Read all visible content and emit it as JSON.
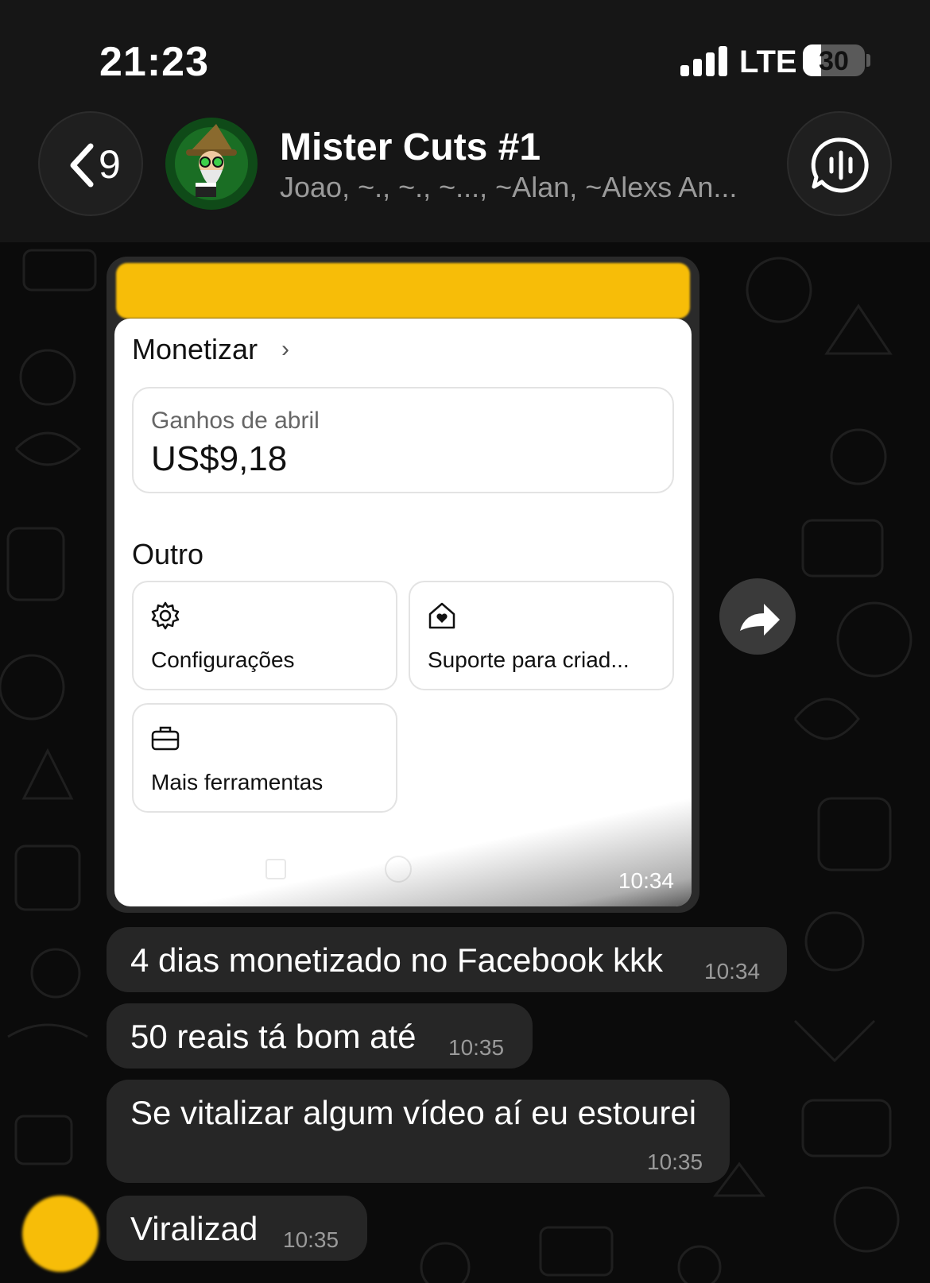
{
  "status_bar": {
    "time": "21:23",
    "network": "LTE",
    "battery": "30",
    "battery_level": 0.3
  },
  "header": {
    "back_count": "9",
    "group_name": "Mister Cuts #1",
    "members": "Joao, ~., ~., ~..., ~Alan, ~Alexs An..."
  },
  "image_message": {
    "time": "10:34",
    "screenshot": {
      "title": "Monetizar",
      "chevron": "›",
      "earnings_label": "Ganhos de abril",
      "earnings_value": "US$9,18",
      "other_title": "Outro",
      "tools": [
        {
          "label": "Configurações",
          "icon": "gear-icon"
        },
        {
          "label": "Suporte para criad...",
          "icon": "home-heart-icon"
        },
        {
          "label": "Mais ferramentas",
          "icon": "briefcase-icon"
        }
      ]
    }
  },
  "messages": [
    {
      "text": "4 dias monetizado no Facebook kkk",
      "time": "10:34"
    },
    {
      "text": "50 reais tá bom até",
      "time": "10:35"
    },
    {
      "text": "Se vitalizar algum vídeo aí eu estourei",
      "time": "10:35"
    },
    {
      "text": "Viralizad",
      "time": "10:35"
    }
  ],
  "colors": {
    "background": "#0b0b0b",
    "bubble": "#262626",
    "redaction": "#f7bd08"
  }
}
